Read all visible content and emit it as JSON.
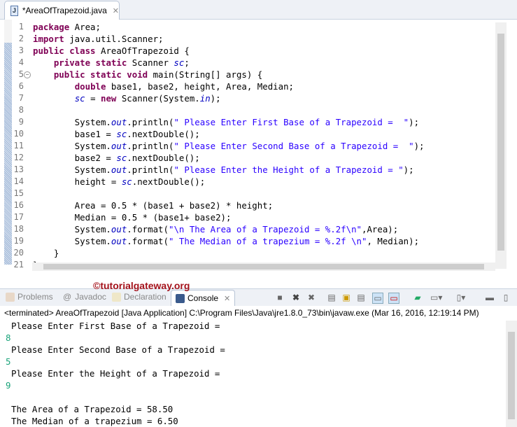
{
  "editor_tab": {
    "title": "*AreaOfTrapezoid.java"
  },
  "code_lines": [
    [
      [
        "package",
        "kw"
      ],
      [
        " Area;",
        ""
      ]
    ],
    [
      [
        "import",
        "kw"
      ],
      [
        " java.util.Scanner;",
        ""
      ]
    ],
    [
      [
        "public class",
        "kw"
      ],
      [
        " AreaOfTrapezoid {",
        ""
      ]
    ],
    [
      [
        "    ",
        ""
      ],
      [
        "private static",
        "kw"
      ],
      [
        " Scanner ",
        ""
      ],
      [
        "sc",
        "fld"
      ],
      [
        ";",
        ""
      ]
    ],
    [
      [
        "    ",
        ""
      ],
      [
        "public static void",
        "kw"
      ],
      [
        " main(String[] args) {",
        ""
      ]
    ],
    [
      [
        "        ",
        ""
      ],
      [
        "double",
        "kw"
      ],
      [
        " base1, base2, height, Area, Median;",
        ""
      ]
    ],
    [
      [
        "        ",
        ""
      ],
      [
        "sc",
        "fld"
      ],
      [
        " = ",
        ""
      ],
      [
        "new",
        "kw"
      ],
      [
        " Scanner(System.",
        ""
      ],
      [
        "in",
        "fld"
      ],
      [
        ");",
        ""
      ]
    ],
    [
      [
        "",
        ""
      ]
    ],
    [
      [
        "        System.",
        ""
      ],
      [
        "out",
        "fld"
      ],
      [
        ".println(",
        ""
      ],
      [
        "\" Please Enter First Base of a Trapezoid =  \"",
        "str"
      ],
      [
        ");",
        ""
      ]
    ],
    [
      [
        "        base1 = ",
        ""
      ],
      [
        "sc",
        "fld"
      ],
      [
        ".nextDouble();",
        ""
      ]
    ],
    [
      [
        "        System.",
        ""
      ],
      [
        "out",
        "fld"
      ],
      [
        ".println(",
        ""
      ],
      [
        "\" Please Enter Second Base of a Trapezoid =  \"",
        "str"
      ],
      [
        ");",
        ""
      ]
    ],
    [
      [
        "        base2 = ",
        ""
      ],
      [
        "sc",
        "fld"
      ],
      [
        ".nextDouble();",
        ""
      ]
    ],
    [
      [
        "        System.",
        ""
      ],
      [
        "out",
        "fld"
      ],
      [
        ".println(",
        ""
      ],
      [
        "\" Please Enter the Height of a Trapezoid = \"",
        "str"
      ],
      [
        ");",
        ""
      ]
    ],
    [
      [
        "        height = ",
        ""
      ],
      [
        "sc",
        "fld"
      ],
      [
        ".nextDouble();",
        ""
      ]
    ],
    [
      [
        "",
        ""
      ]
    ],
    [
      [
        "        Area = 0.5 * (base1 + base2) * height;",
        ""
      ]
    ],
    [
      [
        "        Median = 0.5 * (base1+ base2);",
        ""
      ]
    ],
    [
      [
        "        System.",
        ""
      ],
      [
        "out",
        "fld"
      ],
      [
        ".format(",
        ""
      ],
      [
        "\"\\n The Area of a Trapezoid = %.2f\\n\"",
        "str"
      ],
      [
        ",Area);",
        ""
      ]
    ],
    [
      [
        "        System.",
        ""
      ],
      [
        "out",
        "fld"
      ],
      [
        ".format(",
        ""
      ],
      [
        "\" The Median of a trapezium = %.2f \\n\"",
        "str"
      ],
      [
        ", Median);",
        ""
      ]
    ],
    [
      [
        "    }",
        ""
      ]
    ],
    [
      [
        "}",
        ""
      ]
    ]
  ],
  "watermark": "©tutorialgateway.org",
  "console_tabs": [
    "Problems",
    "Javadoc",
    "Declaration",
    "Console"
  ],
  "terminated": "<terminated> AreaOfTrapezoid [Java Application] C:\\Program Files\\Java\\jre1.8.0_73\\bin\\javaw.exe (Mar 16, 2016, 12:19:14 PM)",
  "output": [
    {
      "t": "Please Enter First Base of a Trapezoid =",
      "in": false
    },
    {
      "t": "8",
      "in": true
    },
    {
      "t": "Please Enter Second Base of a Trapezoid =",
      "in": false
    },
    {
      "t": "5",
      "in": true
    },
    {
      "t": "Please Enter the Height of a Trapezoid =",
      "in": false
    },
    {
      "t": "9",
      "in": true
    },
    {
      "t": "",
      "in": false
    },
    {
      "t": "The Area of a Trapezoid = 58.50",
      "in": false
    },
    {
      "t": "The Median of a trapezium = 6.50",
      "in": false
    }
  ]
}
